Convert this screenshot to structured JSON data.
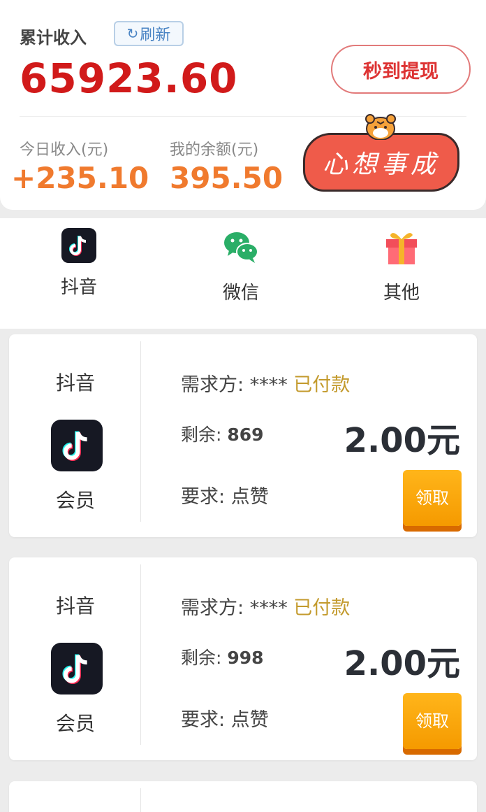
{
  "summary": {
    "total_label": "累计收入",
    "refresh_label": "刷新",
    "total_value": "65923.60",
    "withdraw_label": "秒到提现",
    "today_label": "今日收入(元)",
    "today_value": "+235.10",
    "balance_label": "我的余额(元)",
    "balance_value": "395.50",
    "sticker_text": "心想事成"
  },
  "categories": [
    {
      "label": "抖音",
      "icon": "tiktok-icon"
    },
    {
      "label": "微信",
      "icon": "wechat-icon"
    },
    {
      "label": "其他",
      "icon": "gift-icon"
    }
  ],
  "tasks": [
    {
      "platform": "抖音",
      "tier": "会员",
      "buyer_label": "需求方:",
      "buyer_value": "****",
      "paid_status": "已付款",
      "remain_label": "剩余:",
      "remain_value": "869",
      "price": "2.00元",
      "req_label": "要求:",
      "req_value": "点赞",
      "claim_label": "领取"
    },
    {
      "platform": "抖音",
      "tier": "会员",
      "buyer_label": "需求方:",
      "buyer_value": "****",
      "paid_status": "已付款",
      "remain_label": "剩余:",
      "remain_value": "998",
      "price": "2.00元",
      "req_label": "要求:",
      "req_value": "点赞",
      "claim_label": "领取"
    }
  ],
  "colors": {
    "accent_red": "#d11a1a",
    "accent_orange": "#f07a2e",
    "paid_gold": "#c39a2c",
    "claim_orange": "#f59a00"
  }
}
